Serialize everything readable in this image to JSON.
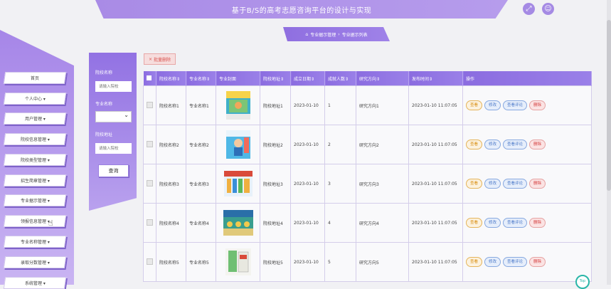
{
  "header": {
    "title": "基于B/S的高考志愿咨询平台的设计与实现"
  },
  "top_icons": [
    {
      "icon": "expand-icon",
      "glyph": "⤢"
    },
    {
      "icon": "user-icon",
      "glyph": "☺"
    }
  ],
  "sidebar": {
    "items": [
      {
        "label": "首页"
      },
      {
        "label": "个人中心 ▾"
      },
      {
        "label": "用户管理 ▾"
      },
      {
        "label": "院校信息管理 ▾"
      },
      {
        "label": "院校类型管理 ▾"
      },
      {
        "label": "招生简章管理 ▾"
      },
      {
        "label": "专业据示管理 ▾"
      },
      {
        "label": "领报信息管理 ▾"
      },
      {
        "label": "专业名称管理 ▾"
      },
      {
        "label": "录取分数管理 ▾"
      },
      {
        "label": "系统管理 ▾"
      }
    ]
  },
  "breadcrumb": {
    "home_icon": "⌂",
    "section": "专业据示管理",
    "separator": "›",
    "page": "专业据示列表"
  },
  "search": {
    "school_name_label": "院校名称",
    "school_name_placeholder": "请输入院校",
    "major_name_label": "专业名称",
    "major_select_value": "",
    "school_address_label": "院校地址",
    "school_address_placeholder": "请输入院校",
    "search_button": "查询"
  },
  "batch_delete": {
    "icon": "×",
    "label": "批量删除"
  },
  "table": {
    "headers": [
      "院校名称⇕",
      "专业名称⇕",
      "专业封面",
      "院校地址⇕",
      "成立日期⇕",
      "成就人数⇕",
      "研究方向⇕",
      "发布时间⇕",
      "操作"
    ],
    "rows": [
      {
        "school": "院校名称1",
        "major": "专业名称1",
        "address": "院校地址1",
        "date": "2023-01-10",
        "count": "1",
        "direction": "研究方向1",
        "time": "2023-01-10 11:07:05"
      },
      {
        "school": "院校名称2",
        "major": "专业名称2",
        "address": "院校地址2",
        "date": "2023-01-10",
        "count": "2",
        "direction": "研究方向2",
        "time": "2023-01-10 11:07:05"
      },
      {
        "school": "院校名称3",
        "major": "专业名称3",
        "address": "院校地址3",
        "date": "2023-01-10",
        "count": "3",
        "direction": "研究方向3",
        "time": "2023-01-10 11:07:05"
      },
      {
        "school": "院校名称4",
        "major": "专业名称4",
        "address": "院校地址4",
        "date": "2023-01-10",
        "count": "4",
        "direction": "研究方向4",
        "time": "2023-01-10 11:07:05"
      },
      {
        "school": "院校名称5",
        "major": "专业名称5",
        "address": "院校地址5",
        "date": "2023-01-10",
        "count": "5",
        "direction": "研究方向5",
        "time": "2023-01-10 11:07:05"
      }
    ],
    "actions": {
      "view": "查看",
      "edit": "修改",
      "comment": "查看评论",
      "delete": "删除"
    }
  },
  "back_to_top": "Top",
  "colors": {
    "accent": "#8b6ce0",
    "sidebar": "#a686e8",
    "view": "#d78b0b",
    "edit": "#4a78c8",
    "delete": "#d33b3b"
  }
}
